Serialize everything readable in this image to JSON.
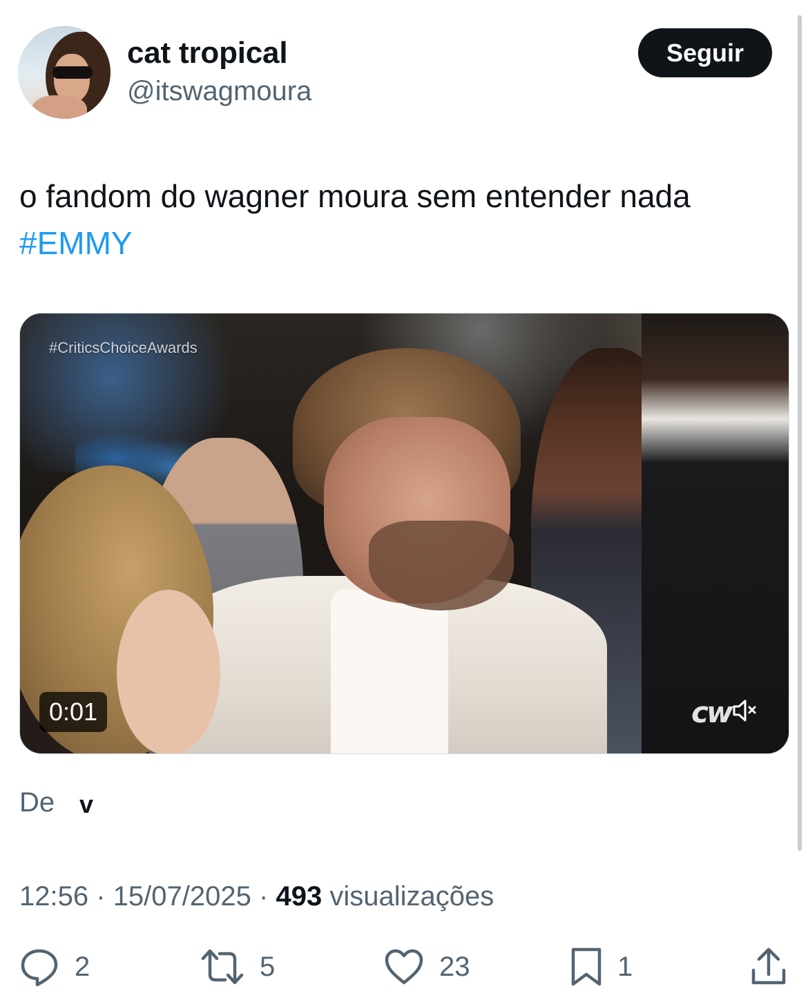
{
  "author": {
    "display_name": "cat tropical",
    "handle": "@itswagmoura"
  },
  "follow_button": {
    "label": "Seguir"
  },
  "tweet": {
    "text": "o fandom do wagner moura sem entender nada",
    "hashtag": "#EMMY"
  },
  "video": {
    "watermark": "#CriticsChoiceAwards",
    "elapsed": "0:01",
    "channel_logo": "cw",
    "muted": true
  },
  "source": {
    "label": "De",
    "user": "v"
  },
  "meta": {
    "time": "12:56",
    "separator": "·",
    "date": "15/07/2025",
    "views": "493",
    "views_label": "visualizações"
  },
  "actions": {
    "replies": "2",
    "reposts": "5",
    "likes": "23",
    "bookmarks": "1"
  },
  "colors": {
    "text": "#0f1419",
    "secondary": "#536471",
    "link": "#1d9bf0",
    "button_bg": "#0f1419"
  }
}
